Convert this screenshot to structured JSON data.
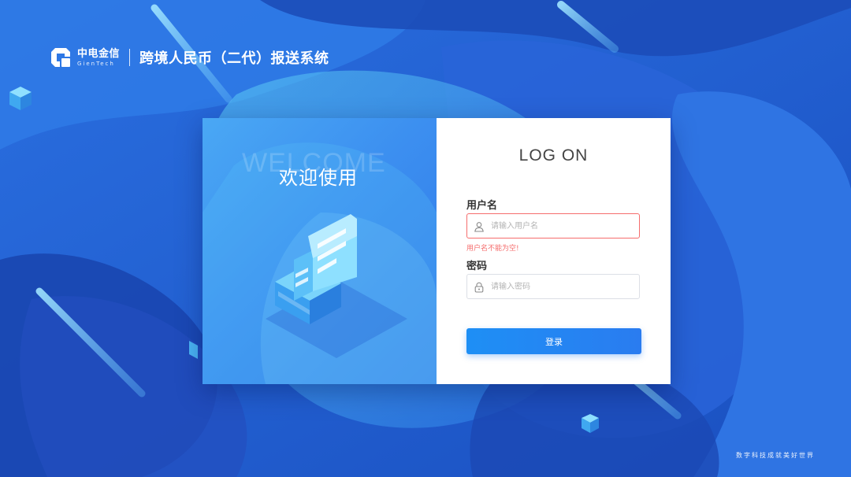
{
  "header": {
    "logo_cn": "中电金信",
    "logo_en": "GienTech",
    "system_title": "跨境人民币（二代）报送系统"
  },
  "welcome": {
    "bg_text": "WELCOME",
    "title": "欢迎使用"
  },
  "login": {
    "title": "LOG ON",
    "username_label": "用户名",
    "username_placeholder": "请输入用户名",
    "username_value": "",
    "username_error": "用户名不能为空!",
    "password_label": "密码",
    "password_placeholder": "请输入密码",
    "password_value": "",
    "submit_label": "登录"
  },
  "footer": {
    "slogan": "数字科技成就美好世界"
  },
  "icons": [
    "logo-icon",
    "user-icon",
    "lock-icon",
    "document-tray-icon"
  ],
  "colors": {
    "accent": "#2a7cf0",
    "error": "#f56c6c",
    "background": "#1f5fd6"
  }
}
